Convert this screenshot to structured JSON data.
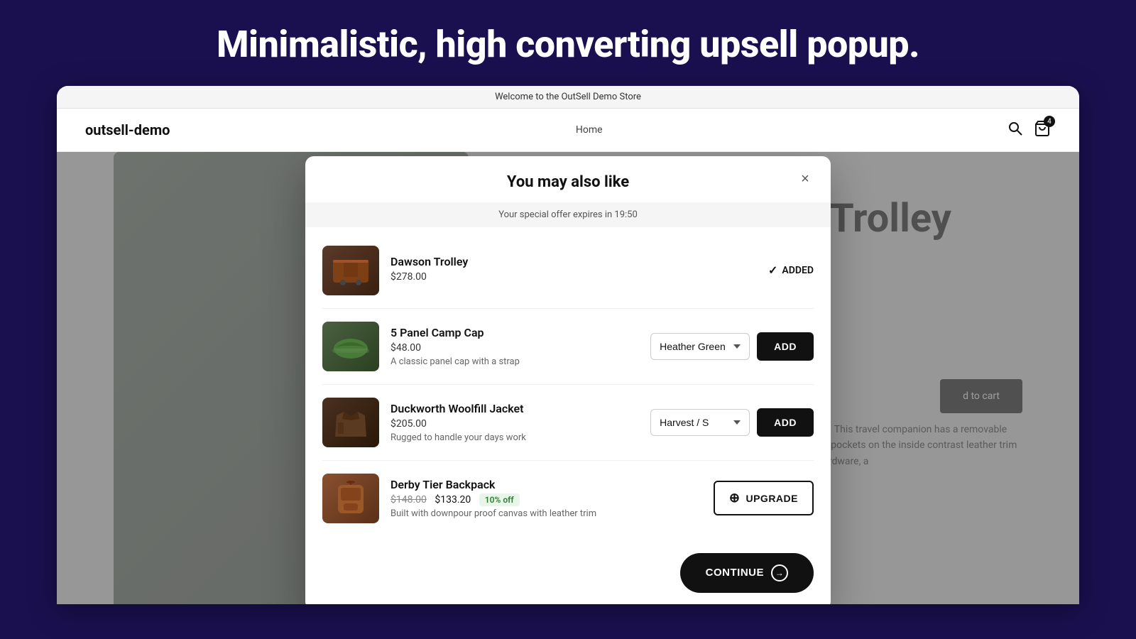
{
  "page": {
    "heading": "Minimalistic, high converting upsell popup."
  },
  "store": {
    "topbar_text": "Welcome to the OutSell Demo Store",
    "logo": "outsell-demo",
    "nav": [
      "Home"
    ],
    "cart_count": "4"
  },
  "modal": {
    "title": "You may also like",
    "close_label": "×",
    "offer_text": "Your special offer expires in 19:50",
    "products": [
      {
        "id": "dawson-trolley",
        "name": "Dawson Trolley",
        "price": "$278.00",
        "original_price": null,
        "sale_price": null,
        "discount": null,
        "description": null,
        "status": "added",
        "added_label": "ADDED",
        "image_type": "trolley"
      },
      {
        "id": "5-panel-camp-cap",
        "name": "5 Panel Camp Cap",
        "price": "$48.00",
        "original_price": null,
        "sale_price": null,
        "discount": null,
        "description": "A classic panel cap with a strap",
        "status": "add",
        "action_label": "ADD",
        "variant": "Heather Green",
        "image_type": "cap"
      },
      {
        "id": "duckworth-woolfill-jacket",
        "name": "Duckworth Woolfill Jacket",
        "price": "$205.00",
        "original_price": null,
        "sale_price": null,
        "discount": null,
        "description": "Rugged to handle your days work",
        "status": "add",
        "action_label": "ADD",
        "variant": "Harvest / S",
        "image_type": "jacket"
      },
      {
        "id": "derby-tier-backpack",
        "name": "Derby Tier Backpack",
        "price": null,
        "original_price": "$148.00",
        "sale_price": "$133.20",
        "discount": "10% off",
        "description": "Built with downpour proof canvas with leather trim",
        "status": "upgrade",
        "action_label": "UPGRADE",
        "image_type": "backpack"
      }
    ],
    "continue_label": "CONTINUE"
  }
}
